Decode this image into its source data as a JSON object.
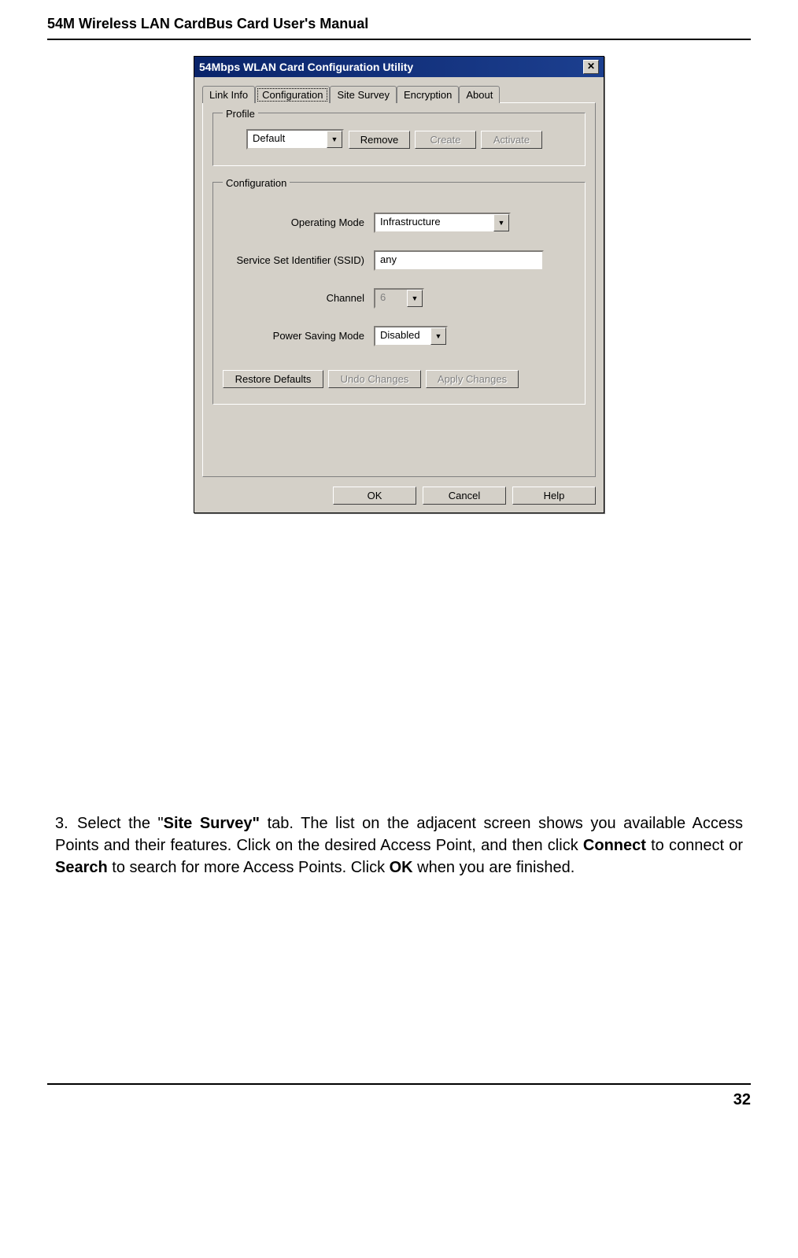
{
  "header": {
    "title": "54M Wireless LAN CardBus Card User's Manual"
  },
  "dialog": {
    "title": "54Mbps WLAN Card Configuration Utility",
    "close_symbol": "✕",
    "tabs": {
      "link_info": "Link Info",
      "configuration": "Configuration",
      "site_survey": "Site Survey",
      "encryption": "Encryption",
      "about": "About"
    },
    "profile": {
      "legend": "Profile",
      "value": "Default",
      "remove": "Remove",
      "create": "Create",
      "activate": "Activate"
    },
    "configuration": {
      "legend": "Configuration",
      "operating_mode_label": "Operating Mode",
      "operating_mode_value": "Infrastructure",
      "ssid_label": "Service Set Identifier (SSID)",
      "ssid_value": "any",
      "channel_label": "Channel",
      "channel_value": "6",
      "power_saving_label": "Power Saving Mode",
      "power_saving_value": "Disabled",
      "restore_defaults": "Restore Defaults",
      "undo_changes": "Undo Changes",
      "apply_changes": "Apply Changes"
    },
    "bottom": {
      "ok": "OK",
      "cancel": "Cancel",
      "help": "Help"
    }
  },
  "instruction": {
    "number": "3.",
    "text_parts": {
      "p1": "Select the \"",
      "p2": "Site Survey\"",
      "p3": " tab. The list on the adjacent screen shows you available Access Points and their features. Click on the desired Access Point, and then click ",
      "p4": "Connect",
      "p5": " to connect or ",
      "p6": "Search",
      "p7": " to search for more Access Points. Click ",
      "p8": "OK",
      "p9": " when you are finished."
    }
  },
  "page_number": "32"
}
